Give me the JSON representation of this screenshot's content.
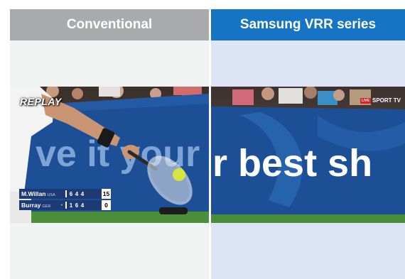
{
  "left_panel": {
    "title": "Conventional",
    "replay_label": "REPLAY",
    "banner_text": "ve it your",
    "scoreboard": [
      {
        "name": "M.Willan",
        "country": "USA",
        "serving": "",
        "sets": [
          "6",
          "4",
          "4"
        ],
        "points": "15"
      },
      {
        "name": "Burray",
        "country": "GER",
        "serving": "•",
        "sets": [
          "1",
          "6",
          "4"
        ],
        "points": "0"
      }
    ]
  },
  "right_panel": {
    "title": "Samsung VRR series",
    "banner_text": "r best sh",
    "channel": {
      "badge": "LIVE",
      "name": "SPORT TV"
    }
  },
  "colors": {
    "left_header": "#a9aaab",
    "right_header": "#1575c4",
    "left_bg": "#f1f2f2",
    "right_bg": "#dde4f5",
    "banner": "#1d4f96"
  }
}
